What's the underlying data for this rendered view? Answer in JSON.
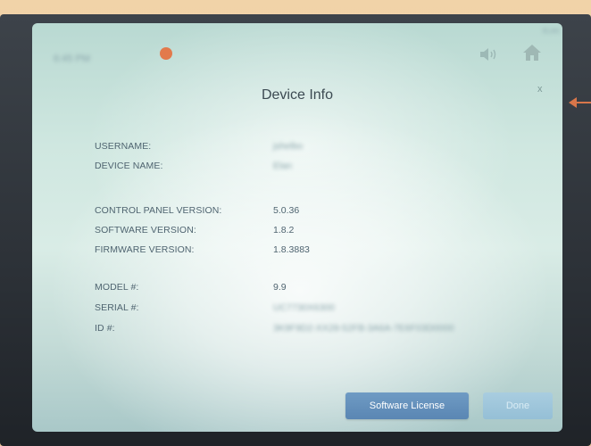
{
  "status": {
    "time": "6:45 PM",
    "corner_text": "ELAN"
  },
  "dialog": {
    "title": "Device Info",
    "close_label": "x"
  },
  "fields": {
    "username_label": "USERNAME:",
    "username_value": "jshelbo",
    "device_name_label": "DEVICE NAME:",
    "device_name_value": "Elan",
    "control_panel_version_label": "CONTROL PANEL VERSION:",
    "control_panel_version_value": "5.0.36",
    "software_version_label": "SOFTWARE VERSION:",
    "software_version_value": "1.8.2",
    "firmware_version_label": "FIRMWARE VERSION:",
    "firmware_version_value": "1.8.3883",
    "model_label": "MODEL #:",
    "model_value": "9.9",
    "serial_label": "SERIAL #:",
    "serial_value": "UC7730X6300",
    "id_label": "ID #:",
    "id_value": "3K9F9D2-XX28-52FB-3A6A-7E6F03D0000"
  },
  "buttons": {
    "software_license": "Software License",
    "done": "Done"
  },
  "colors": {
    "status_dot": "#e27a4c",
    "primary_button": "#5f8cb8",
    "disabled_button": "#9ec6da",
    "text": "#4f6470"
  },
  "icons": {
    "speaker": "speaker-icon",
    "home": "home-icon",
    "arrow": "arrow-left-icon"
  }
}
